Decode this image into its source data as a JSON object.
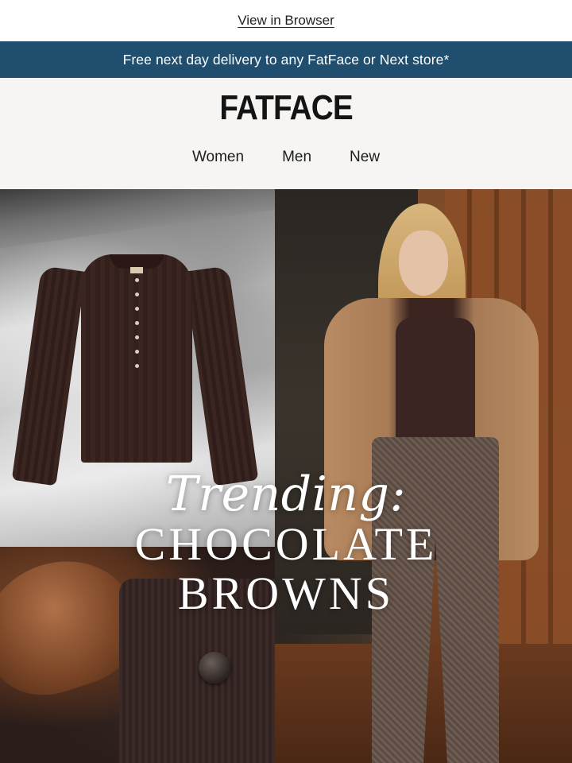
{
  "topbar": {
    "view_in_browser": "View in Browser"
  },
  "promo": {
    "text": "Free next day delivery to any FatFace or Next store*"
  },
  "header": {
    "logo": "FATFACE",
    "nav": [
      {
        "label": "Women"
      },
      {
        "label": "Men"
      },
      {
        "label": "New"
      }
    ]
  },
  "hero": {
    "kicker": "Trending:",
    "title_line_1": "CHOCOLATE",
    "title_line_2": "BROWNS"
  },
  "colors": {
    "promo_bg": "#1f4e6e",
    "header_bg": "#f6f5f3",
    "accent_brown": "#3b2521"
  }
}
